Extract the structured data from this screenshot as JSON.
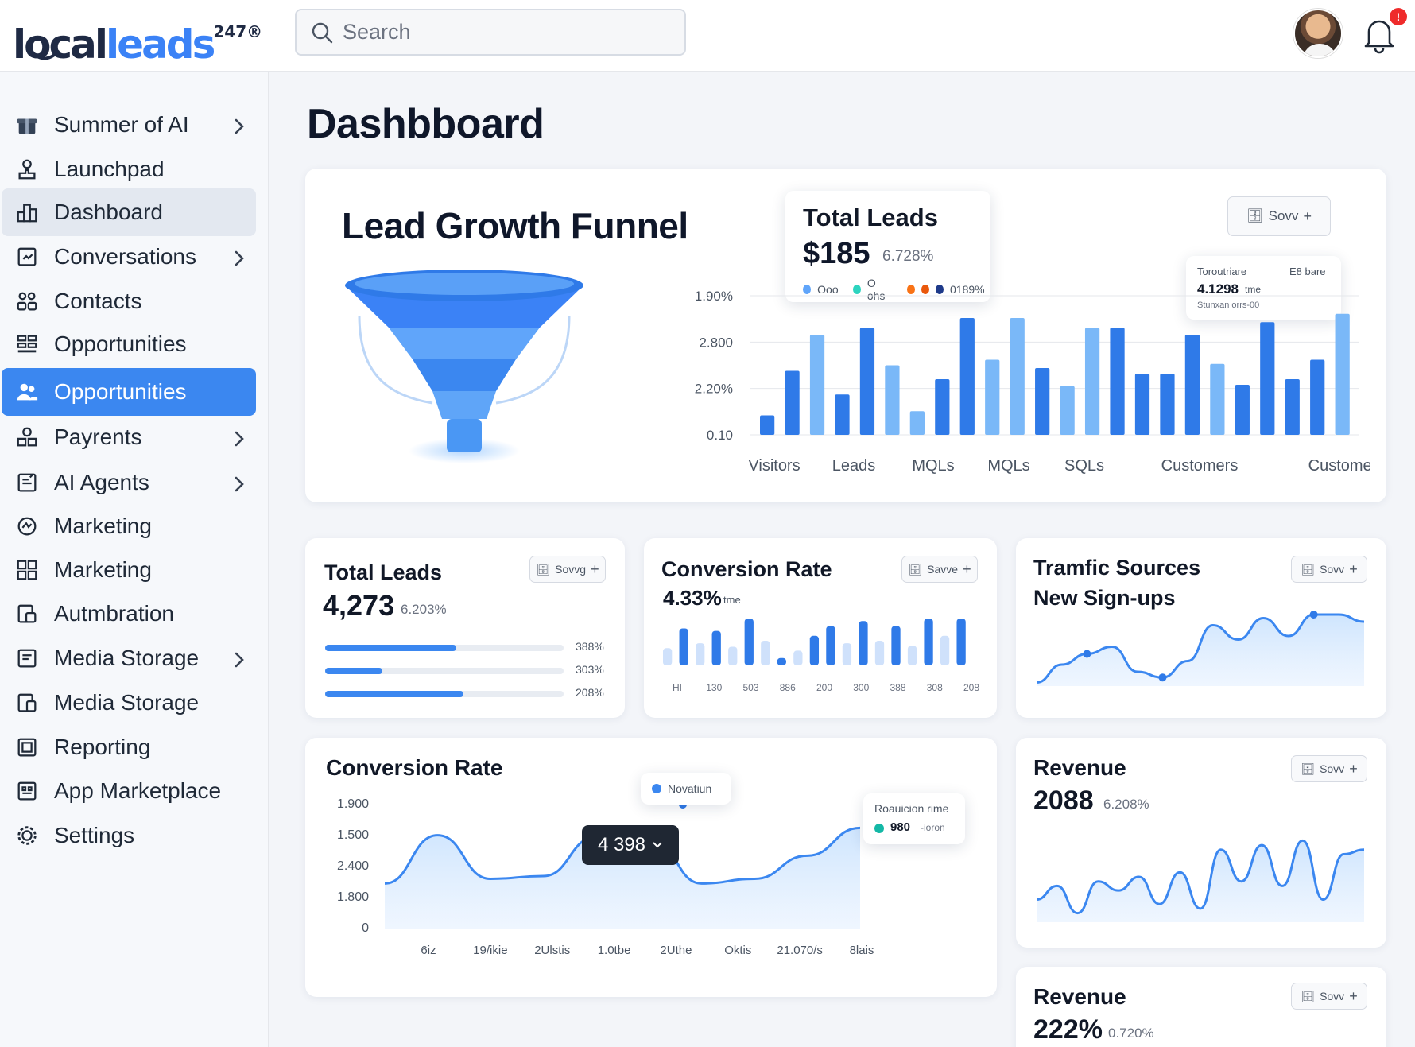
{
  "brand": {
    "local": "local",
    "leads": "leads",
    "suffix": "247",
    "reg": "®"
  },
  "search": {
    "placeholder": "Search"
  },
  "notifications": {
    "badge": "!"
  },
  "sidebar": {
    "items": [
      {
        "label": "Summer of AI",
        "icon": "gift-icon",
        "chevron": true
      },
      {
        "label": "Launchpad",
        "icon": "rocket-icon",
        "chevron": false
      },
      {
        "label": "Dashboard",
        "icon": "dashboard-icon",
        "chevron": false,
        "state": "hover"
      },
      {
        "label": "Conversations",
        "icon": "chat-icon",
        "chevron": true
      },
      {
        "label": "Contacts",
        "icon": "contacts-icon",
        "chevron": false
      },
      {
        "label": "Opportunities",
        "icon": "grid-icon",
        "chevron": false
      },
      {
        "label": "Opportunities",
        "icon": "users-icon",
        "chevron": false,
        "state": "active"
      },
      {
        "label": "Payrents",
        "icon": "payments-icon",
        "chevron": true
      },
      {
        "label": "AI Agents",
        "icon": "robot-icon",
        "chevron": true
      },
      {
        "label": "Marketing",
        "icon": "megaphone-icon",
        "chevron": false
      },
      {
        "label": "Marketing",
        "icon": "layout-icon",
        "chevron": false
      },
      {
        "label": "Autmbration",
        "icon": "automation-icon",
        "chevron": false
      },
      {
        "label": "Media Storage",
        "icon": "folder-icon",
        "chevron": true
      },
      {
        "label": "Media Storage",
        "icon": "files-icon",
        "chevron": false
      },
      {
        "label": "Reporting",
        "icon": "report-icon",
        "chevron": false
      },
      {
        "label": "App Marketplace",
        "icon": "marketplace-icon",
        "chevron": false
      },
      {
        "label": "Settings",
        "icon": "gear-icon",
        "chevron": false
      }
    ]
  },
  "page": {
    "title": "Dashbboard"
  },
  "funnel_card": {
    "title": "Lead Growth Funnel",
    "save_button": "Sovv",
    "total_leads": {
      "title": "Total Leads",
      "value": "$185",
      "pct": "6.728%",
      "legend": [
        {
          "label": "Ooo",
          "color": "#60a5fa"
        },
        {
          "label": "O ohs",
          "color": "#2dd4bf"
        },
        {
          "label": "",
          "color": "#f97316"
        },
        {
          "label": "",
          "color": "#ea580c"
        },
        {
          "label": "0189%",
          "color": "#1e3a8a"
        }
      ]
    },
    "tooltip": {
      "line1": "Toroutriare",
      "line1b": "E8 bare",
      "value": "4.1298",
      "value_unit": "tme",
      "line3": "Stunxan orrs-00"
    },
    "chart_data": {
      "type": "bar",
      "y_tick_labels": [
        "1.90%",
        "2.800",
        "2.20%",
        "0.10"
      ],
      "x_labels": [
        "Visitors",
        "Leads",
        "MQLs",
        "MQLs",
        "SQLs",
        "Customers",
        "Customers"
      ],
      "values": [
        0.14,
        0.46,
        0.72,
        0.29,
        0.77,
        0.5,
        0.17,
        0.4,
        0.84,
        0.54,
        0.84,
        0.48,
        0.35,
        0.77,
        0.77,
        0.44,
        0.44,
        0.72,
        0.51,
        0.36,
        0.81,
        0.4,
        0.54,
        0.87
      ],
      "shades": [
        "d",
        "d",
        "l",
        "d",
        "d",
        "l",
        "l",
        "d",
        "d",
        "l",
        "l",
        "d",
        "l",
        "l",
        "d",
        "d",
        "d",
        "d",
        "l",
        "d",
        "d",
        "d",
        "d",
        "l"
      ],
      "ylim": [
        0,
        1
      ]
    }
  },
  "total_leads_card": {
    "title": "Total Leads",
    "value": "4,273",
    "pct": "6.203%",
    "save_button": "Sovvg",
    "bars": [
      {
        "fraction": 0.55,
        "label": "388%"
      },
      {
        "fraction": 0.24,
        "label": "303%"
      },
      {
        "fraction": 0.58,
        "label": "208%"
      }
    ]
  },
  "conversion_rate_mini": {
    "title": "Conversion Rate",
    "value": "4.33%",
    "unit": "tme",
    "save_button": "Savve",
    "chart_data": {
      "type": "bar",
      "x_labels": [
        "HI",
        "130",
        "503",
        "886",
        "200",
        "300",
        "388",
        "308",
        "208"
      ],
      "values": [
        0.35,
        0.75,
        0.45,
        0.7,
        0.38,
        0.95,
        0.5,
        0.15,
        0.3,
        0.6,
        0.8,
        0.45,
        0.9,
        0.5,
        0.8,
        0.4,
        0.95,
        0.6,
        0.95
      ],
      "shades": [
        "l",
        "d",
        "l",
        "d",
        "l",
        "d",
        "l",
        "d",
        "l",
        "d",
        "d",
        "l",
        "d",
        "l",
        "d",
        "l",
        "d",
        "l",
        "d"
      ],
      "ylim": [
        0,
        1
      ]
    }
  },
  "traffic_card": {
    "title_line1": "Tramfic Sources",
    "title_line2": "New Sign-ups",
    "save_button": "Sovv",
    "chart_data": {
      "type": "area",
      "values": [
        0.05,
        0.3,
        0.45,
        0.55,
        0.2,
        0.12,
        0.35,
        0.85,
        0.65,
        0.95,
        0.7,
        1.0,
        1.0,
        0.9
      ],
      "markers": [
        2,
        5,
        11
      ],
      "ylim": [
        0,
        1
      ]
    }
  },
  "conversion_rate_card": {
    "title": "Conversion Rate",
    "legend_tip": "Novatiun",
    "dark_tip": "4 398",
    "tip2_title": "Roauicion rime",
    "tip2_value": "980",
    "tip2_unit": "-ioron",
    "chart_data": {
      "type": "area",
      "y_tick_labels": [
        "1.900",
        "1.500",
        "2.400",
        "1.800",
        "0"
      ],
      "x_labels": [
        "6iz",
        "19/ikie",
        "2Ulstis",
        "1.0tbe",
        "2Uthe",
        "Oktis",
        "21.070/s",
        "8lais"
      ],
      "values": [
        0.4,
        0.92,
        0.45,
        0.48,
        0.9,
        0.92,
        0.4,
        0.45,
        0.7,
        1.0
      ],
      "ylim": [
        0,
        1.2
      ]
    }
  },
  "revenue_card": {
    "title": "Revenue",
    "value": "2088",
    "pct": "6.208%",
    "save_button": "Sovv",
    "chart_data": {
      "type": "area",
      "values": [
        0.25,
        0.4,
        0.1,
        0.45,
        0.35,
        0.5,
        0.2,
        0.55,
        0.15,
        0.8,
        0.45,
        0.85,
        0.4,
        0.9,
        0.25,
        0.75,
        0.8
      ],
      "ylim": [
        0,
        1
      ]
    }
  },
  "revenue_card2": {
    "title": "Revenue",
    "value": "222%",
    "pct": "0.720%",
    "save_button": "Sovv"
  }
}
